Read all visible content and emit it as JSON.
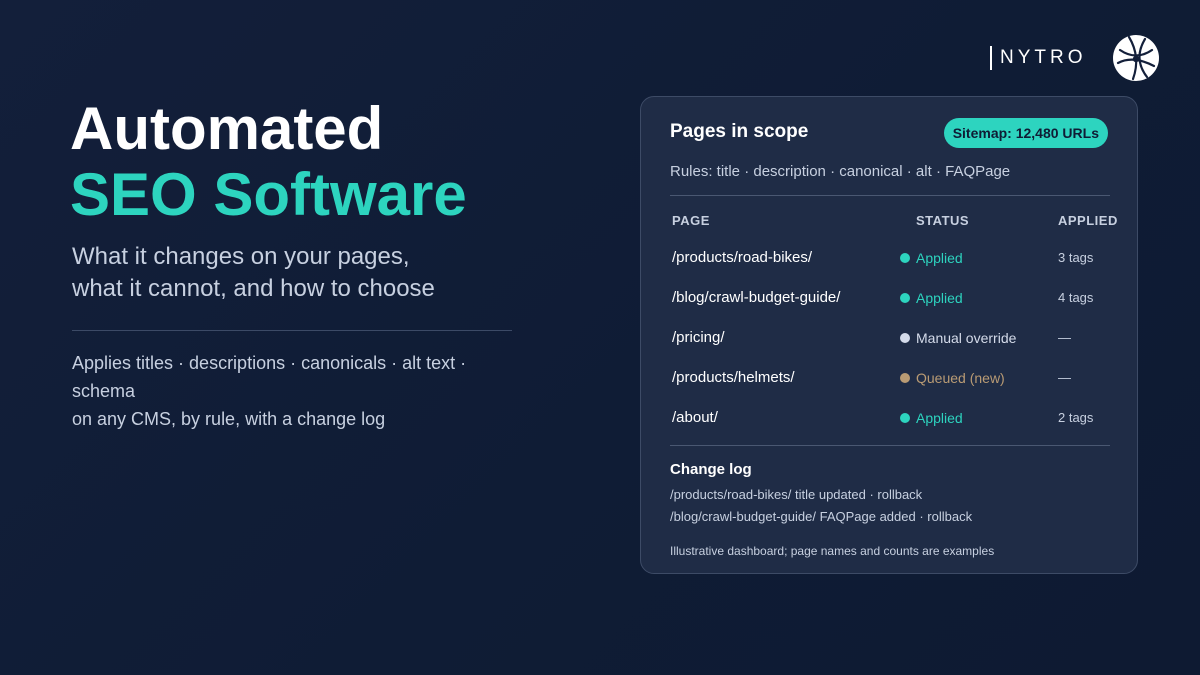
{
  "brand": {
    "name": "NYTRO",
    "logo_icon": "globe-network-icon"
  },
  "hero": {
    "title_line1": "Automated",
    "title_line2": "SEO Software",
    "subtitle_line1": "What it changes on your pages,",
    "subtitle_line2": "what it cannot, and how to choose",
    "desc_line1": "Applies titles · descriptions · canonicals · alt text · schema",
    "desc_line2": "on any CMS, by rule, with a change log"
  },
  "card": {
    "title": "Pages in scope",
    "badge": "Sitemap: 12,480 URLs",
    "rules": "Rules: title · description · canonical · alt · FAQPage",
    "columns": {
      "page": "PAGE",
      "status": "STATUS",
      "applied": "APPLIED"
    },
    "rows": [
      {
        "page": "/products/road-bikes/",
        "status": "Applied",
        "status_color": "#2dd4bf",
        "applied": "3 tags"
      },
      {
        "page": "/blog/crawl-budget-guide/",
        "status": "Applied",
        "status_color": "#2dd4bf",
        "applied": "4 tags"
      },
      {
        "page": "/pricing/",
        "status": "Manual override",
        "status_color": "#d4dbea",
        "applied": "—"
      },
      {
        "page": "/products/helmets/",
        "status": "Queued (new)",
        "status_color": "#b99b74",
        "applied": "—"
      },
      {
        "page": "/about/",
        "status": "Applied",
        "status_color": "#2dd4bf",
        "applied": "2 tags"
      }
    ],
    "change_log": {
      "title": "Change log",
      "entries": [
        "/products/road-bikes/ title updated · rollback",
        "/blog/crawl-budget-guide/ FAQPage added · rollback"
      ]
    },
    "footnote": "Illustrative dashboard; page names and counts are examples"
  },
  "colors": {
    "accent": "#2dd4bf",
    "background": "#131f3a",
    "card": "#1f2c46"
  }
}
